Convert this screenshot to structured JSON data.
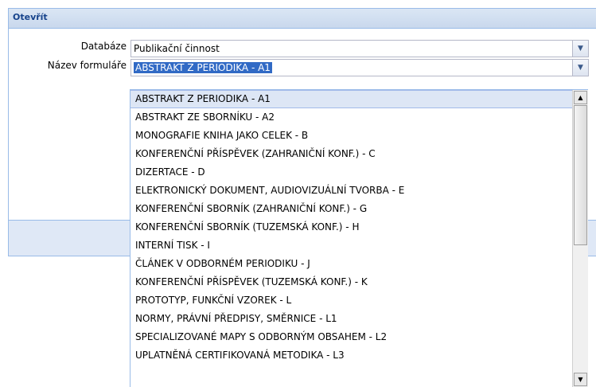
{
  "panel": {
    "title": "Otevřít"
  },
  "form": {
    "database_label": "Databáze",
    "database_value": "Publikační činnost",
    "form_name_label": "Název formuláře",
    "form_name_value": "ABSTRAKT Z PERIODIKA - A1"
  },
  "dropdown": {
    "items": [
      "ABSTRAKT Z PERIODIKA - A1",
      "ABSTRAKT ZE SBORNÍKU - A2",
      "MONOGRAFIE KNIHA JAKO CELEK - B",
      "KONFERENČNÍ PŘÍSPĚVEK (ZAHRANIČNÍ KONF.) - C",
      "DIZERTACE - D",
      "ELEKTRONICKÝ DOKUMENT, AUDIOVIZUÁLNÍ TVORBA - E",
      "KONFERENČNÍ SBORNÍK (ZAHRANIČNÍ KONF.) - G",
      "KONFERENČNÍ SBORNÍK (TUZEMSKÁ KONF.) - H",
      "INTERNÍ TISK - I",
      "ČLÁNEK V ODBORNÉM PERIODIKU - J",
      "KONFERENČNÍ PŘÍSPĚVEK (TUZEMSKÁ KONF.) - K",
      "PROTOTYP, FUNKČNÍ VZOREK - L",
      "NORMY, PRÁVNÍ PŘEDPISY, SMĚRNICE - L1",
      "SPECIALIZOVANÉ MAPY S ODBORNÝM OBSAHEM - L2",
      "UPLATNĚNÁ CERTIFIKOVANÁ METODIKA - L3"
    ]
  },
  "icons": {
    "trigger": "chevron-down-icon",
    "scroll_up": "arrow-up-icon",
    "scroll_down": "arrow-down-icon"
  },
  "colors": {
    "header_text": "#15428b",
    "panel_bg": "#dfe8f6",
    "selection": "#316ac5",
    "hover": "#dde6f5"
  }
}
